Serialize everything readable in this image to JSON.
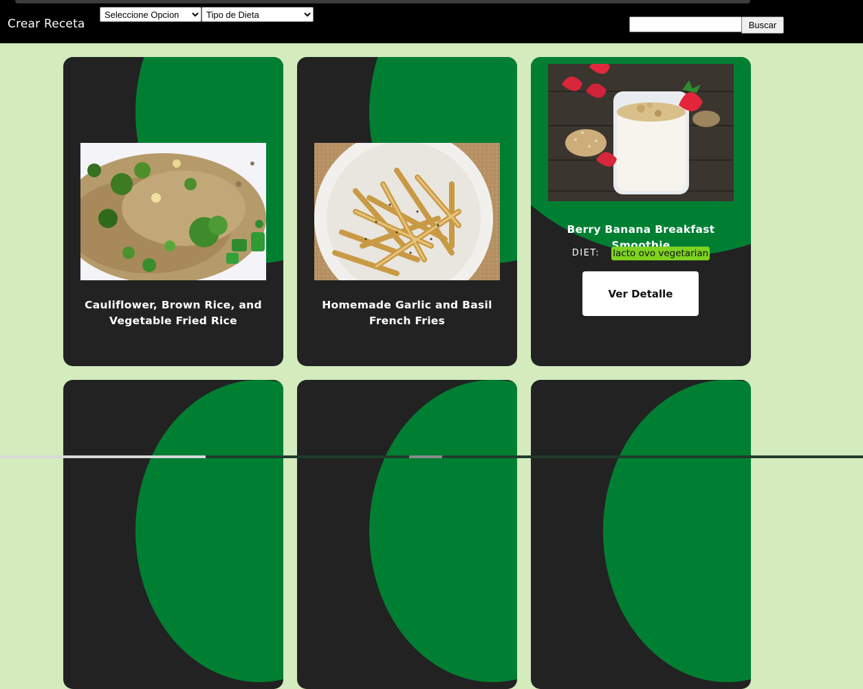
{
  "navbar": {
    "brand": "Crear Receta",
    "order_select": {
      "selected": "Seleccione Opcion"
    },
    "diet_select": {
      "selected": "Tipo de Dieta"
    },
    "search": {
      "value": "",
      "button_label": "Buscar"
    }
  },
  "colors": {
    "page_background": "#d3ebbd",
    "card_background": "#222222",
    "card_accent": "#007f33",
    "diet_tag": "#7ed321"
  },
  "recipes": [
    {
      "title": "Cauliflower, Brown Rice, and Vegetable Fried Rice",
      "image": "fried-rice-photo"
    },
    {
      "title": "Homemade Garlic and Basil French Fries",
      "image": "french-fries-photo"
    },
    {
      "title": "Berry Banana Breakfast Smoothie",
      "image": "smoothie-photo",
      "diet_label": "DIET:",
      "diet": "lacto ovo vegetarian",
      "detail_button": "Ver Detalle"
    }
  ]
}
